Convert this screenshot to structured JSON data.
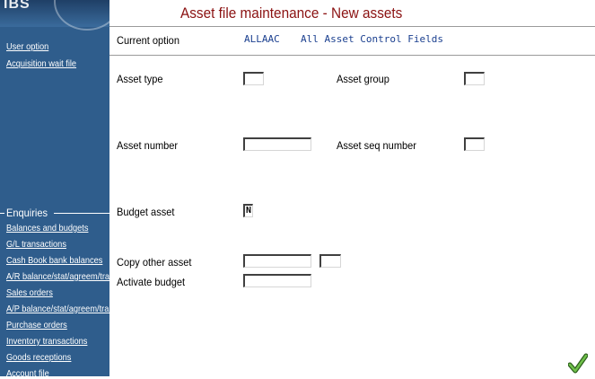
{
  "logo": {
    "text": "IBS"
  },
  "sidebar": {
    "top_items": [
      {
        "label": "User option"
      },
      {
        "label": "Acquisition wait file"
      }
    ],
    "enquiries_header": "Enquiries",
    "items": [
      {
        "label": "Balances and budgets"
      },
      {
        "label": "G/L transactions"
      },
      {
        "label": "Cash Book bank balances"
      },
      {
        "label": "A/R balance/stat/agreem/trar"
      },
      {
        "label": "Sales orders"
      },
      {
        "label": "A/P balance/stat/agreem/trar"
      },
      {
        "label": "Purchase orders"
      },
      {
        "label": "Inventory transactions"
      },
      {
        "label": "Goods receptions"
      },
      {
        "label": "Account file"
      }
    ]
  },
  "main": {
    "title": "Asset file maintenance - New assets",
    "current_option_label": "Current option",
    "current_option_code": "ALLAAC",
    "current_option_desc": "All Asset Control Fields"
  },
  "form": {
    "asset_type": {
      "label": "Asset type",
      "value": ""
    },
    "asset_group": {
      "label": "Asset group",
      "value": ""
    },
    "asset_number": {
      "label": "Asset number",
      "value": ""
    },
    "asset_seq_number": {
      "label": "Asset seq number",
      "value": ""
    },
    "budget_asset": {
      "label": "Budget asset",
      "value": "N"
    },
    "copy_other_asset": {
      "label": "Copy other asset",
      "value": "",
      "value2": ""
    },
    "activate_budget": {
      "label": "Activate budget",
      "value": ""
    }
  },
  "icons": {
    "ok": "checkmark-icon"
  },
  "colors": {
    "sidebar": "#2f5d8c",
    "title": "#8b1212",
    "option_text": "#1a3f8f",
    "ok": "#3f8f2a"
  }
}
